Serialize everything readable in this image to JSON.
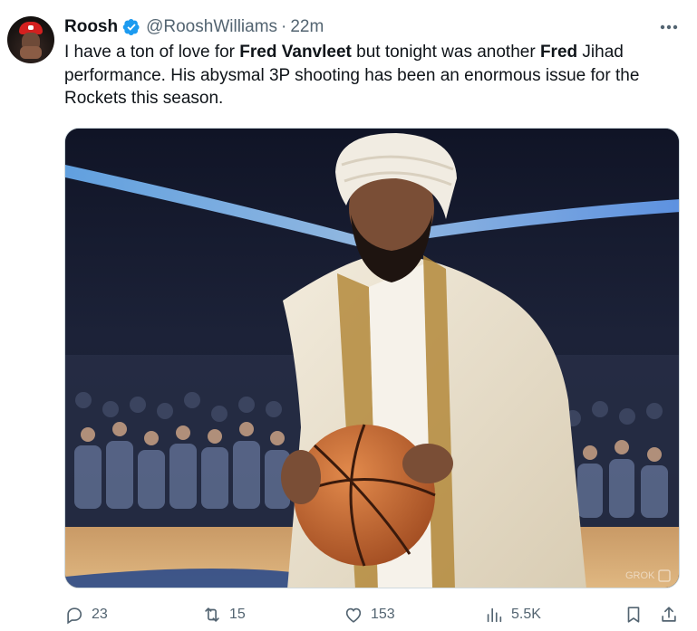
{
  "tweet": {
    "author_name": "Roosh",
    "handle": "@RooshWilliams",
    "separator": "·",
    "time": "22m",
    "text_segments": [
      {
        "t": "I have a ton of love for ",
        "bold": false
      },
      {
        "t": "Fred Vanvleet",
        "bold": true
      },
      {
        "t": " but tonight was another ",
        "bold": false
      },
      {
        "t": "Fred",
        "bold": true
      },
      {
        "t": " Jihad performance. His abysmal 3P shooting has been an enormous issue for the Rockets this season.",
        "bold": false
      }
    ]
  },
  "media": {
    "watermark": "GROK"
  },
  "actions": {
    "reply_count": "23",
    "retweet_count": "15",
    "like_count": "153",
    "view_count": "5.5K"
  },
  "icons": {
    "verified": "verified-badge-icon",
    "more": "more-icon",
    "reply": "reply-icon",
    "retweet": "retweet-icon",
    "like": "heart-icon",
    "views": "views-icon",
    "bookmark": "bookmark-icon",
    "share": "share-icon"
  },
  "colors": {
    "verified": "#1d9bf0",
    "text": "#0f1419",
    "secondary": "#536471"
  }
}
